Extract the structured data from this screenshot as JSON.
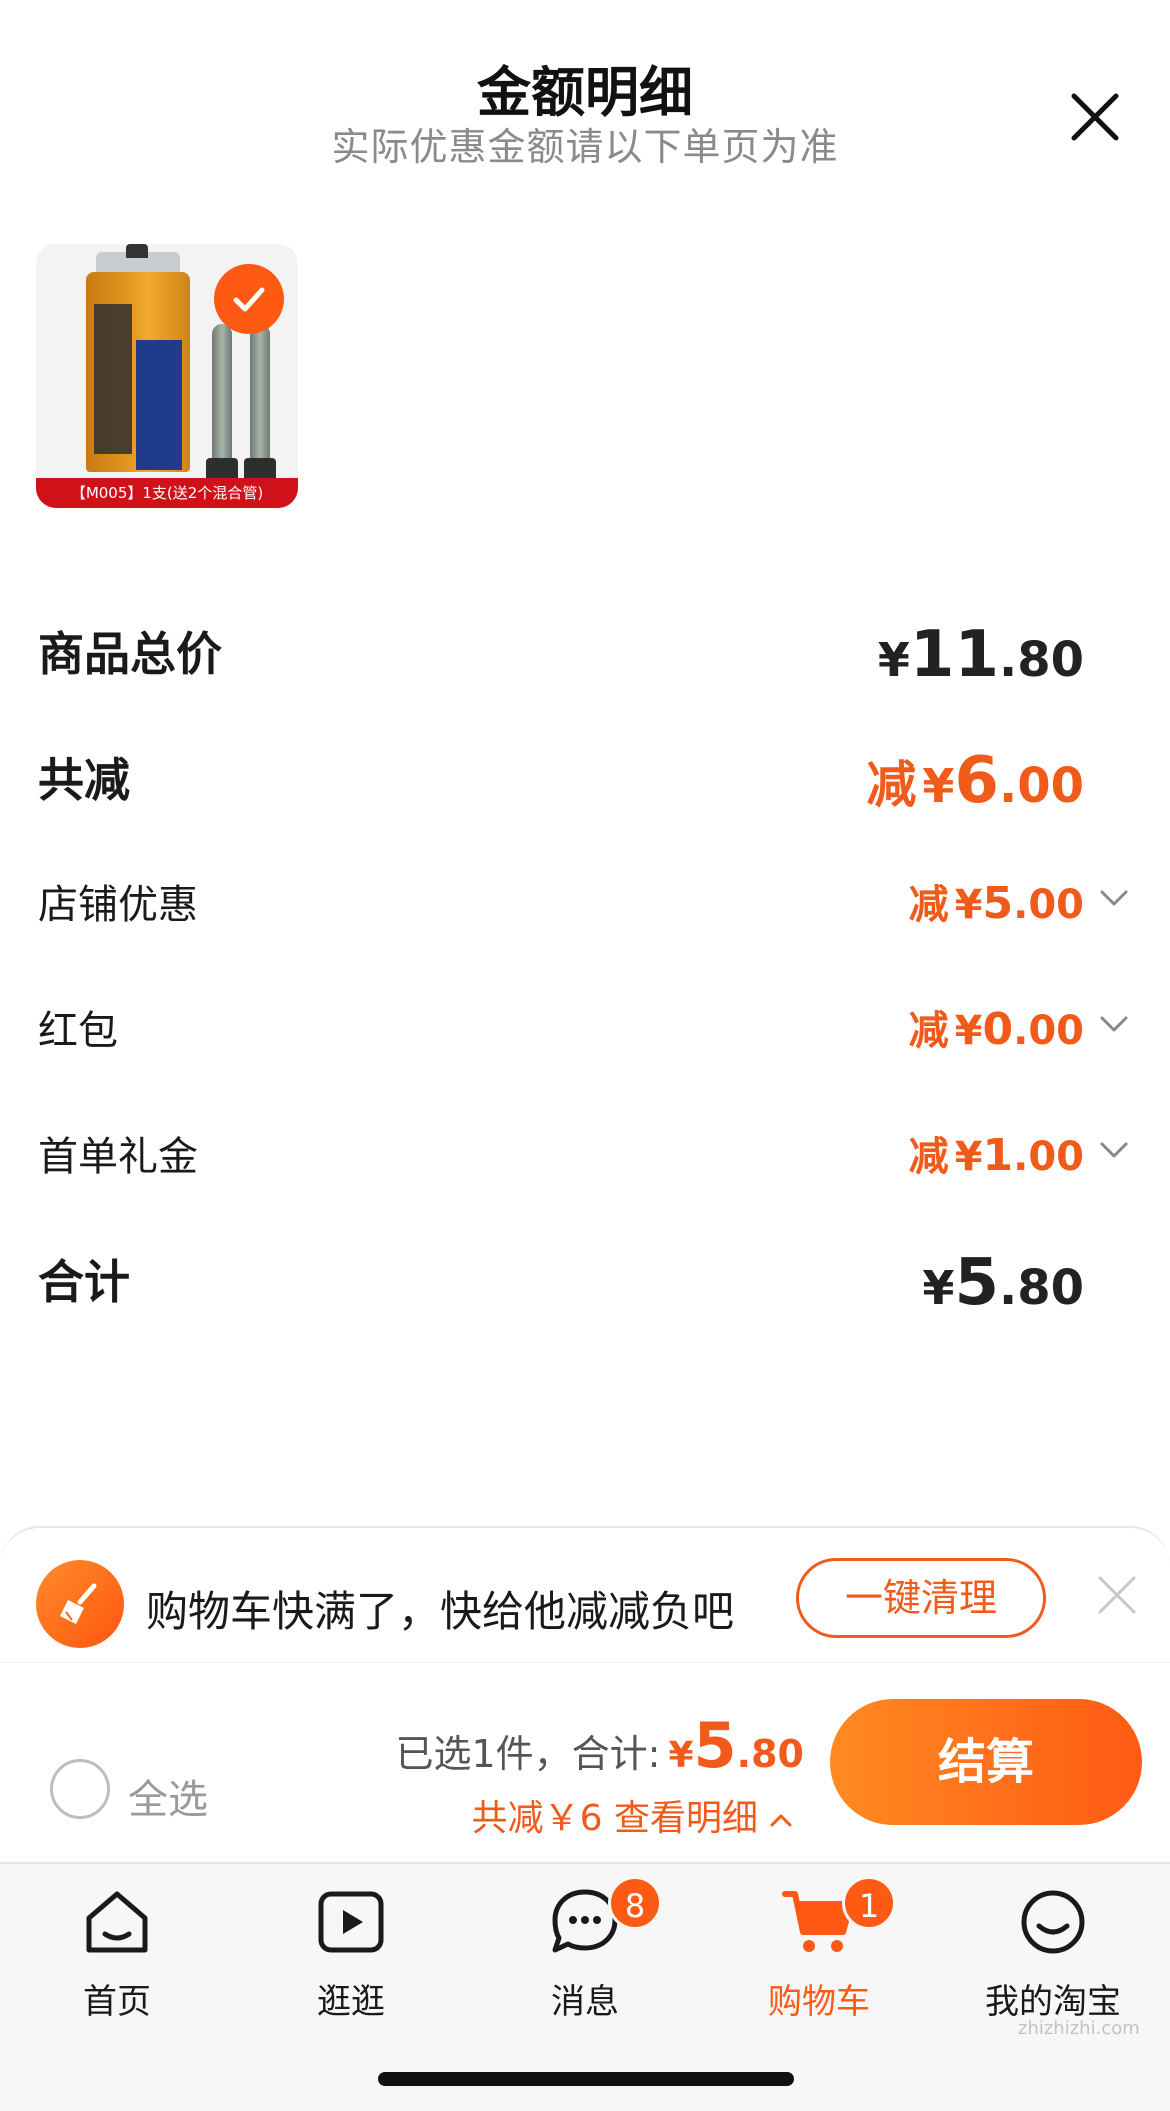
{
  "header": {
    "title": "金额明细",
    "subtitle": "实际优惠金额请以下单页为准"
  },
  "product": {
    "caption": "【M005】1支(送2个混合管)",
    "selected": true,
    "tube_texts": [
      "EPOXY ADHESIVE",
      "M005",
      "高强度AB结构胶"
    ]
  },
  "breakdown": {
    "total_price": {
      "label": "商品总价",
      "currency": "¥",
      "int": "11",
      "dec": ".80"
    },
    "total_discount": {
      "label": "共减",
      "prefix": "减",
      "currency": "¥",
      "int": "6",
      "dec": ".00"
    },
    "shop_discount": {
      "label": "店铺优惠",
      "prefix": "减",
      "currency": "¥",
      "int": "5",
      "dec": ".00"
    },
    "red_packet": {
      "label": "红包",
      "prefix": "减",
      "currency": "¥",
      "int": "0",
      "dec": ".00"
    },
    "first_order_gift": {
      "label": "首单礼金",
      "prefix": "减",
      "currency": "¥",
      "int": "1",
      "dec": ".00"
    },
    "grand_total": {
      "label": "合计",
      "currency": "¥",
      "int": "5",
      "dec": ".80"
    }
  },
  "notice": {
    "text": "购物车快满了，快给他减减负吧",
    "button": "一键清理"
  },
  "checkout": {
    "select_all": "全选",
    "selected_summary": "已选1件，合计:",
    "currency": "¥",
    "total_int": "5",
    "total_dec": ".80",
    "discount_text": "共减￥6  查看明细",
    "checkout_button": "结算"
  },
  "tabs": [
    {
      "label": "首页",
      "icon": "home-icon"
    },
    {
      "label": "逛逛",
      "icon": "play-icon"
    },
    {
      "label": "消息",
      "icon": "message-icon",
      "badge": "8"
    },
    {
      "label": "购物车",
      "icon": "cart-icon",
      "badge": "1",
      "active": true
    },
    {
      "label": "我的淘宝",
      "icon": "profile-icon"
    }
  ],
  "colors": {
    "accent": "#ff5a14",
    "discount_text": "#f05a1a",
    "badge": "#ff5a14"
  },
  "watermark": "zhizhizhi.com"
}
